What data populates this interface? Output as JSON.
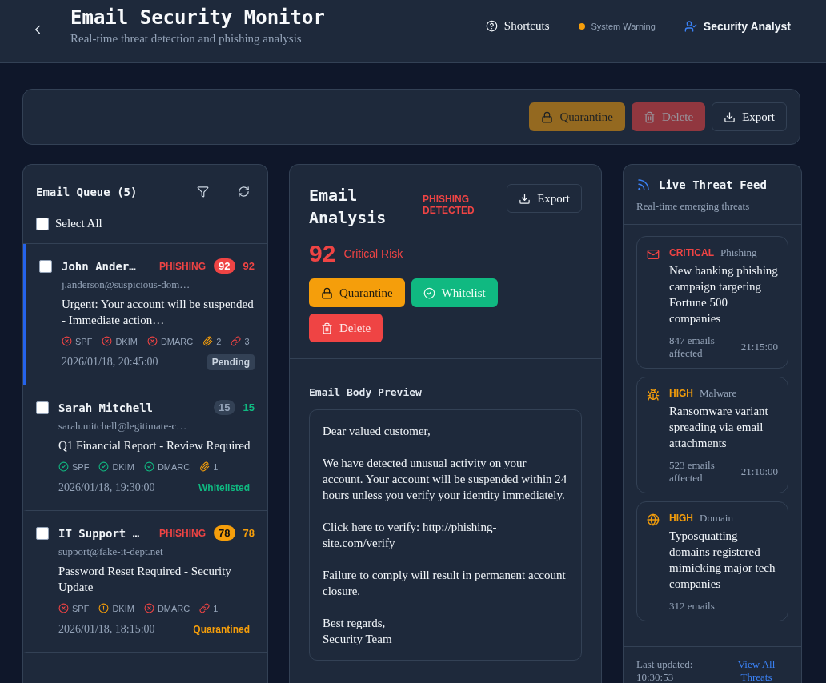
{
  "header": {
    "title": "Email Security Monitor",
    "subtitle": "Real-time threat detection and phishing analysis",
    "shortcuts": "Shortcuts",
    "status": {
      "label": "System Warning",
      "color": "#f59e0b"
    },
    "user": "Security Analyst"
  },
  "toolbar": [
    {
      "kind": "quarantine",
      "label": "Quarantine",
      "disabled": true
    },
    {
      "kind": "delete",
      "label": "Delete",
      "disabled": true
    },
    {
      "kind": "export",
      "label": "Export",
      "disabled": false
    }
  ],
  "queue": {
    "title": "Email Queue (5)",
    "select_all": {
      "label": "Select All",
      "checked": false
    },
    "emails": [
      {
        "sender": "John Ander…",
        "tag": "PHISHING",
        "color": "#ef4444",
        "badge": "92",
        "score": "92",
        "email": "j.anderson@suspicious-dom…",
        "subject": "Urgent: Your account will be suspended - Immediate action…",
        "checks": [
          {
            "label": "SPF",
            "kind": "fail"
          },
          {
            "label": "DKIM",
            "kind": "fail"
          },
          {
            "label": "DMARC",
            "kind": "fail"
          }
        ],
        "attachments": "2",
        "links": "3",
        "date": "2026/01/18, 20:45:00",
        "status": {
          "label": "Pending",
          "kind": "pending"
        },
        "selected": true,
        "checked": false
      },
      {
        "sender": "Sarah Mitchell",
        "color": "#10b981",
        "badge": "15",
        "score": "15",
        "email": "sarah.mitchell@legitimate-c…",
        "subject": "Q1 Financial Report - Review Required",
        "checks": [
          {
            "label": "SPF",
            "kind": "pass"
          },
          {
            "label": "DKIM",
            "kind": "pass"
          },
          {
            "label": "DMARC",
            "kind": "pass"
          }
        ],
        "attachments": "1",
        "date": "2026/01/18, 19:30:00",
        "status": {
          "label": "Whitelisted",
          "kind": "whitelisted"
        },
        "selected": false,
        "checked": false
      },
      {
        "sender": "IT Support …",
        "tag": "PHISHING",
        "color": "#f59e0b",
        "badge": "78",
        "score": "78",
        "email": "support@fake-it-dept.net",
        "subject": "Password Reset Required - Security Update",
        "checks": [
          {
            "label": "SPF",
            "kind": "fail"
          },
          {
            "label": "DKIM",
            "kind": "warn"
          },
          {
            "label": "DMARC",
            "kind": "fail"
          }
        ],
        "links": "1",
        "date": "2026/01/18, 18:15:00",
        "status": {
          "label": "Quarantined",
          "kind": "quarantined"
        },
        "selected": false,
        "checked": false
      }
    ]
  },
  "analysis": {
    "title": "Email Analysis",
    "verdict": "PHISHING DETECTED",
    "export": "Export",
    "score": "92",
    "risk_label": "Critical Risk",
    "actions": [
      {
        "kind": "quarantine",
        "label": "Quarantine"
      },
      {
        "kind": "whitelist",
        "label": "Whitelist"
      },
      {
        "kind": "delete",
        "label": "Delete"
      }
    ],
    "body_title": "Email Body Preview",
    "body": [
      "Dear valued customer,",
      "We have detected unusual activity on your account. Your account will be suspended within 24 hours unless you verify your identity immediately.",
      "Click here to verify: http://phishing-site.com/verify",
      "Failure to comply will result in permanent account closure.",
      "Best regards,\nSecurity Team"
    ]
  },
  "feed": {
    "title": "Live Threat Feed",
    "subtitle": "Real-time emerging threats",
    "threats": [
      {
        "kind": "mail",
        "severity": "CRITICAL",
        "color": "#ef4444",
        "category": "Phishing",
        "title": "New banking phishing campaign targeting Fortune 500 companies",
        "count": "847 emails affected",
        "time": "21:15:00"
      },
      {
        "kind": "bug",
        "severity": "HIGH",
        "color": "#f59e0b",
        "category": "Malware",
        "title": "Ransomware variant spreading via email attachments",
        "count": "523 emails affected",
        "time": "21:10:00"
      },
      {
        "kind": "globe",
        "severity": "HIGH",
        "color": "#f59e0b",
        "category": "Domain",
        "title": "Typosquatting domains registered mimicking major tech companies",
        "count": "312 emails"
      }
    ],
    "updated": "Last updated: 10:30:53",
    "view_all": "View All Threats"
  }
}
